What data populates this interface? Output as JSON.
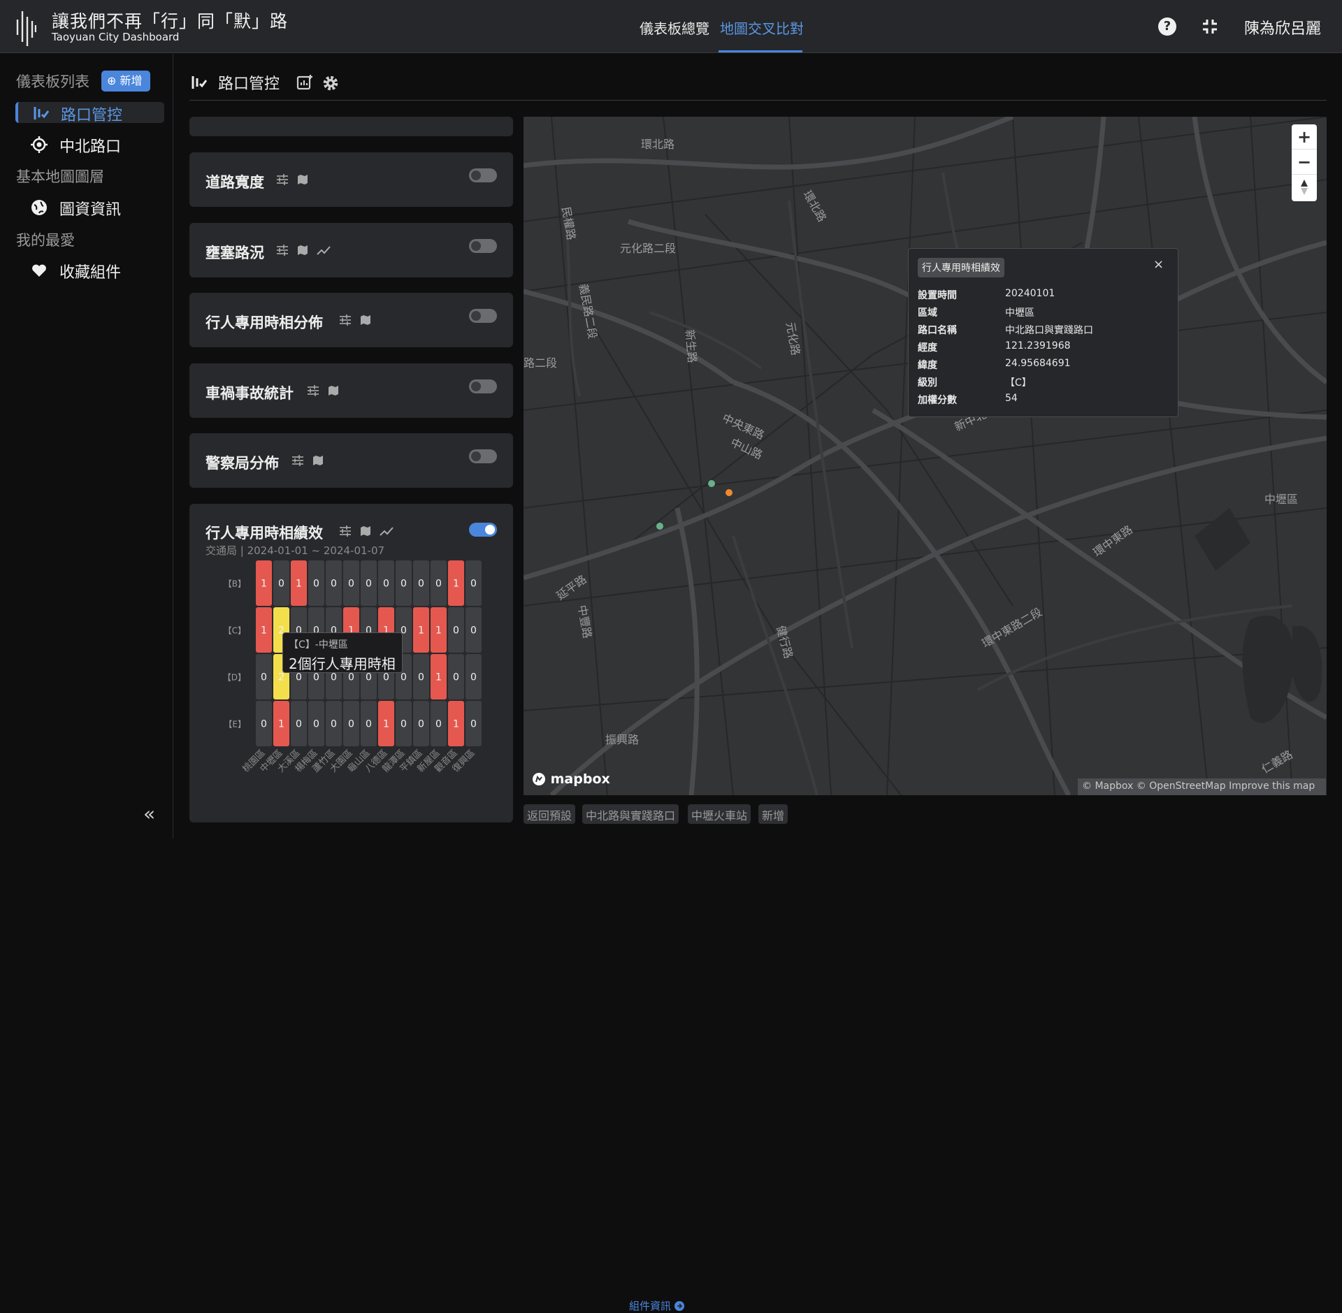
{
  "header": {
    "title": "讓我們不再「行」同「默」路",
    "subtitle": "Taoyuan City Dashboard",
    "tabs": [
      {
        "label": "儀表板總覽"
      },
      {
        "label": "地圖交叉比對"
      }
    ],
    "help": "?",
    "user": "陳為欣呂麗"
  },
  "sidebar": {
    "dash_heading": "儀表板列表",
    "add_label": "⊕ 新增",
    "items": [
      {
        "label": "路口管控",
        "icon": "traffic-icon"
      },
      {
        "label": "中北路口",
        "icon": "target-icon"
      }
    ],
    "base_heading": "基本地圖圖層",
    "base_items": [
      {
        "label": "圖資資訊",
        "icon": "globe-icon"
      }
    ],
    "fav_heading": "我的最愛",
    "fav_items": [
      {
        "label": "收藏組件",
        "icon": "heart-icon"
      }
    ],
    "collapse": "«"
  },
  "main": {
    "title": "路口管控"
  },
  "cards": [
    {
      "title": "道路寬度"
    },
    {
      "title": "壅塞路況"
    },
    {
      "title": "行人專用時相分佈"
    },
    {
      "title": "車禍事故統計"
    },
    {
      "title": "警察局分佈"
    }
  ],
  "heat_card": {
    "title": "行人專用時相績效",
    "source": "交通局 | 2024-01-01 ~ 2024-01-07",
    "info_link": "組件資訊",
    "tooltip": {
      "line1": "【C】-中壢區",
      "line2": "2個行人專用時相"
    }
  },
  "chart_data": {
    "type": "heatmap",
    "rows": [
      "【B】",
      "【C】",
      "【D】",
      "【E】"
    ],
    "columns": [
      "桃園區",
      "中壢區",
      "大溪區",
      "楊梅區",
      "蘆竹區",
      "大園區",
      "龜山區",
      "八德區",
      "龍潭區",
      "平鎮區",
      "新屋區",
      "觀音區",
      "復興區"
    ],
    "values": [
      [
        1,
        0,
        1,
        0,
        0,
        0,
        0,
        0,
        0,
        0,
        0,
        1,
        0
      ],
      [
        1,
        2,
        0,
        0,
        0,
        1,
        0,
        1,
        0,
        1,
        1,
        0,
        0
      ],
      [
        0,
        2,
        0,
        0,
        0,
        0,
        0,
        0,
        0,
        0,
        1,
        0,
        0
      ],
      [
        0,
        1,
        0,
        0,
        0,
        0,
        0,
        1,
        0,
        0,
        0,
        1,
        0
      ]
    ],
    "colors": {
      "zero": "#3f4043",
      "one": "#e5584f",
      "two": "#f3df4c"
    }
  },
  "map": {
    "popup": {
      "title": "行人專用時相績效",
      "close": "×",
      "rows": [
        {
          "k": "設置時間",
          "v": "20240101"
        },
        {
          "k": "區域",
          "v": "中壢區"
        },
        {
          "k": "路口名稱",
          "v": "中北路口與實踐路口"
        },
        {
          "k": "經度",
          "v": "121.2391968"
        },
        {
          "k": "緯度",
          "v": "24.95684691"
        },
        {
          "k": "級別",
          "v": "【C】"
        },
        {
          "k": "加權分數",
          "v": "54"
        }
      ]
    },
    "labels": [
      "環北路",
      "環北路",
      "民權路",
      "元化路二段",
      "義民路二段",
      "新生路",
      "元化路",
      "路二段",
      "中央東路",
      "中山路",
      "延平路",
      "中豐路",
      "健行路",
      "環中東路二段",
      "環中東路",
      "振興路",
      "中壢區",
      "仁義路",
      "新中北路"
    ],
    "logo": "mapbox",
    "attribution": "© Mapbox © OpenStreetMap  Improve this map",
    "chips": [
      "返回預設",
      "中北路與實踐路口",
      "中壢火車站",
      "新增"
    ],
    "zoom_in": "+",
    "zoom_out": "−"
  }
}
